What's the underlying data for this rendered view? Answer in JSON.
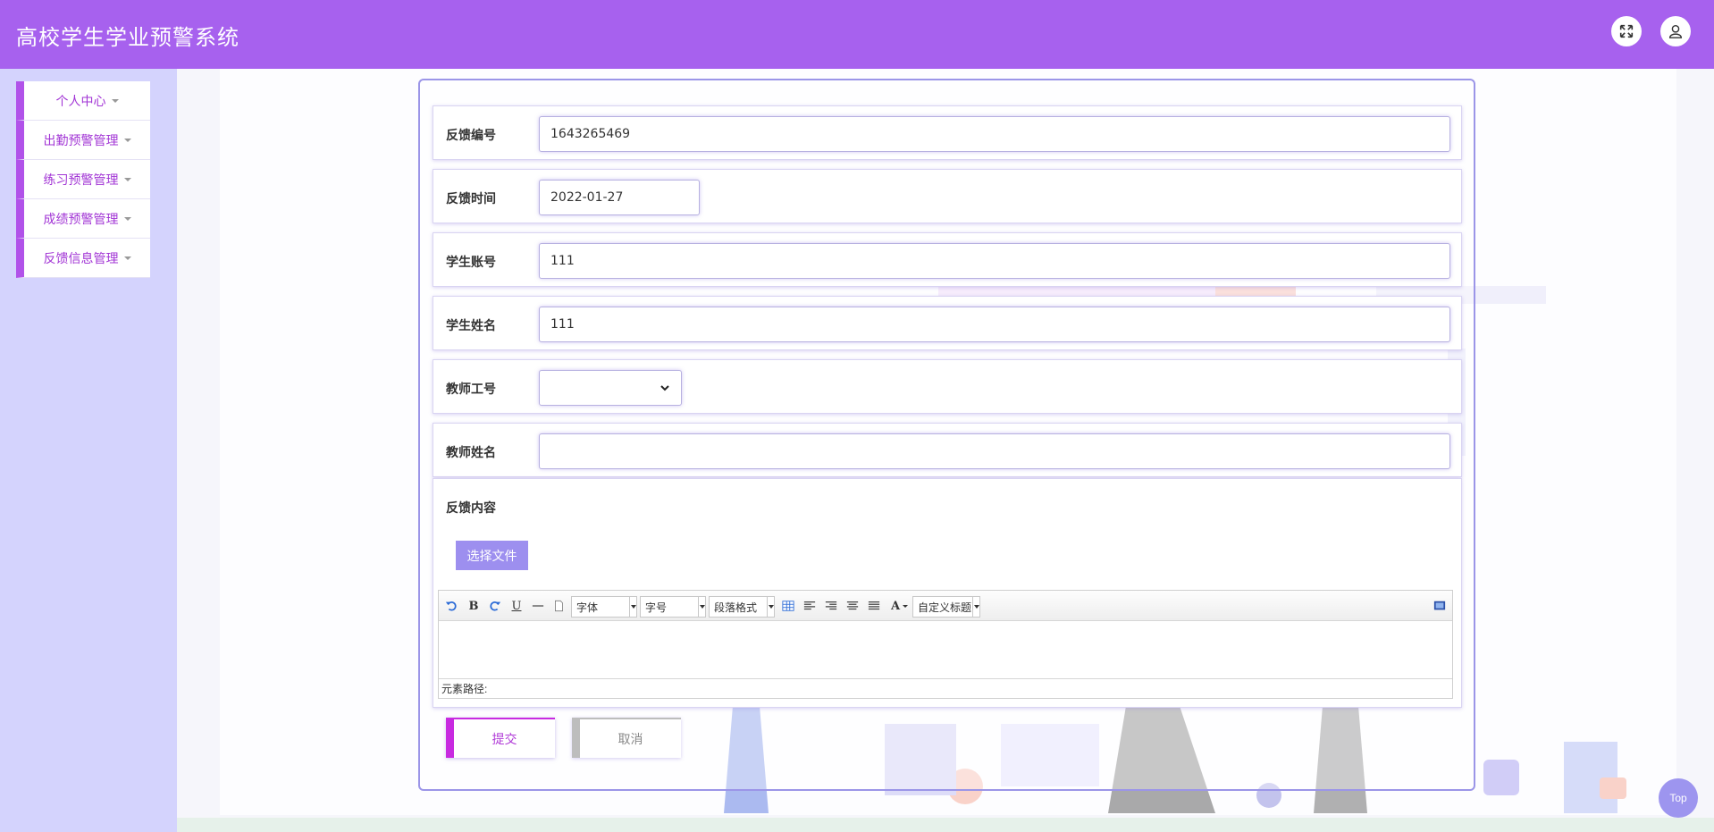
{
  "app": {
    "title": "高校学生学业预警系统"
  },
  "header": {
    "fullscreen_icon": "expand-icon",
    "user_icon": "user-icon"
  },
  "sidebar": {
    "items": [
      {
        "label": "个人中心"
      },
      {
        "label": "出勤预警管理"
      },
      {
        "label": "练习预警管理"
      },
      {
        "label": "成绩预警管理"
      },
      {
        "label": "反馈信息管理"
      }
    ]
  },
  "form": {
    "fields": {
      "feedback_no": {
        "label": "反馈编号",
        "value": "1643265469"
      },
      "feedback_time": {
        "label": "反馈时间",
        "value": "2022-01-27"
      },
      "student_account": {
        "label": "学生账号",
        "value": "111"
      },
      "student_name": {
        "label": "学生姓名",
        "value": "111"
      },
      "teacher_no": {
        "label": "教师工号",
        "value": ""
      },
      "teacher_name": {
        "label": "教师姓名",
        "value": ""
      },
      "content": {
        "label": "反馈内容"
      }
    },
    "file_button": "选择文件",
    "editor": {
      "font_select": "字体",
      "size_select": "字号",
      "paragraph_select": "段落格式",
      "custom_title_select": "自定义标题",
      "bold": "B",
      "underline": "U",
      "font_color": "A",
      "path_label": "元素路径:"
    },
    "submit": "提交",
    "cancel": "取消"
  },
  "top_button": "Top"
}
